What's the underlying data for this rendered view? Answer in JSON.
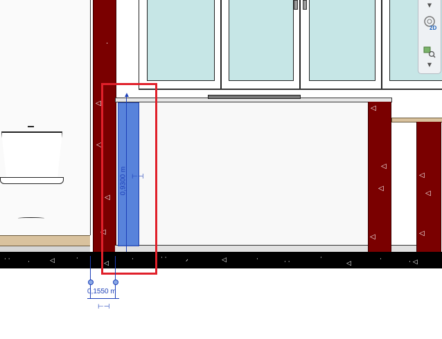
{
  "dimension": {
    "horizontal_label": "0,1550 m",
    "vertical_label": "0,9300 m"
  },
  "navigation_bar": {
    "badge_2d": "2D",
    "dropdown_icon": "chevron-down-icon"
  },
  "colors": {
    "column": "#7a0000",
    "selected_element": "#4a79d8",
    "selection_highlight": "#e0202a",
    "dimension": "#1c3fb8",
    "glass": "#c6e6e6",
    "floor": "#d9c29e",
    "concrete": "#000000"
  }
}
